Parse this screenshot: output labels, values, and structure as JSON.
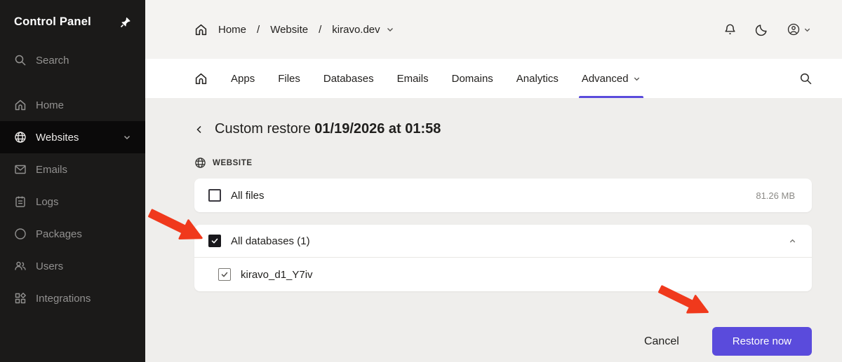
{
  "sidebar": {
    "title": "Control Panel",
    "search_label": "Search",
    "items": [
      {
        "label": "Home",
        "icon": "home-icon",
        "active": false
      },
      {
        "label": "Websites",
        "icon": "globe-icon",
        "active": true
      },
      {
        "label": "Emails",
        "icon": "mail-icon",
        "active": false
      },
      {
        "label": "Logs",
        "icon": "logs-icon",
        "active": false
      },
      {
        "label": "Packages",
        "icon": "circle-icon",
        "active": false
      },
      {
        "label": "Users",
        "icon": "users-icon",
        "active": false
      },
      {
        "label": "Integrations",
        "icon": "integrations-icon",
        "active": false
      }
    ]
  },
  "header": {
    "breadcrumb": [
      "Home",
      "Website",
      "kiravo.dev"
    ],
    "separator": "/",
    "icons": [
      "home-icon",
      "bell-icon",
      "moon-icon",
      "user-circle-icon",
      "chevron-down-icon"
    ]
  },
  "tabs": {
    "items": [
      "Apps",
      "Files",
      "Databases",
      "Emails",
      "Domains",
      "Analytics",
      "Advanced"
    ],
    "active": "Advanced",
    "icons": [
      "home-icon",
      "search-icon"
    ]
  },
  "page": {
    "title_regular": "Custom restore",
    "title_bold": "01/19/2026 at 01:58",
    "section_label": "WEBSITE",
    "section_icon": "globe-icon"
  },
  "restore": {
    "all_files": {
      "label": "All files",
      "size": "81.26 MB",
      "checked": false
    },
    "all_databases": {
      "label": "All databases (1)",
      "checked": true,
      "expanded": true,
      "children": [
        {
          "label": "kiravo_d1_Y7iv",
          "checked": true
        }
      ]
    }
  },
  "footer": {
    "cancel_label": "Cancel",
    "restore_label": "Restore now"
  },
  "annotations": {
    "arrow_count": 2,
    "arrow_color": "#f0391c"
  },
  "colors": {
    "accent": "#5a4bdc",
    "sidebar_bg": "#1b1a19",
    "sidebar_active_bg": "#0b0a0a",
    "topbar_bg": "#f4f3f1",
    "content_bg": "#efeeec"
  }
}
